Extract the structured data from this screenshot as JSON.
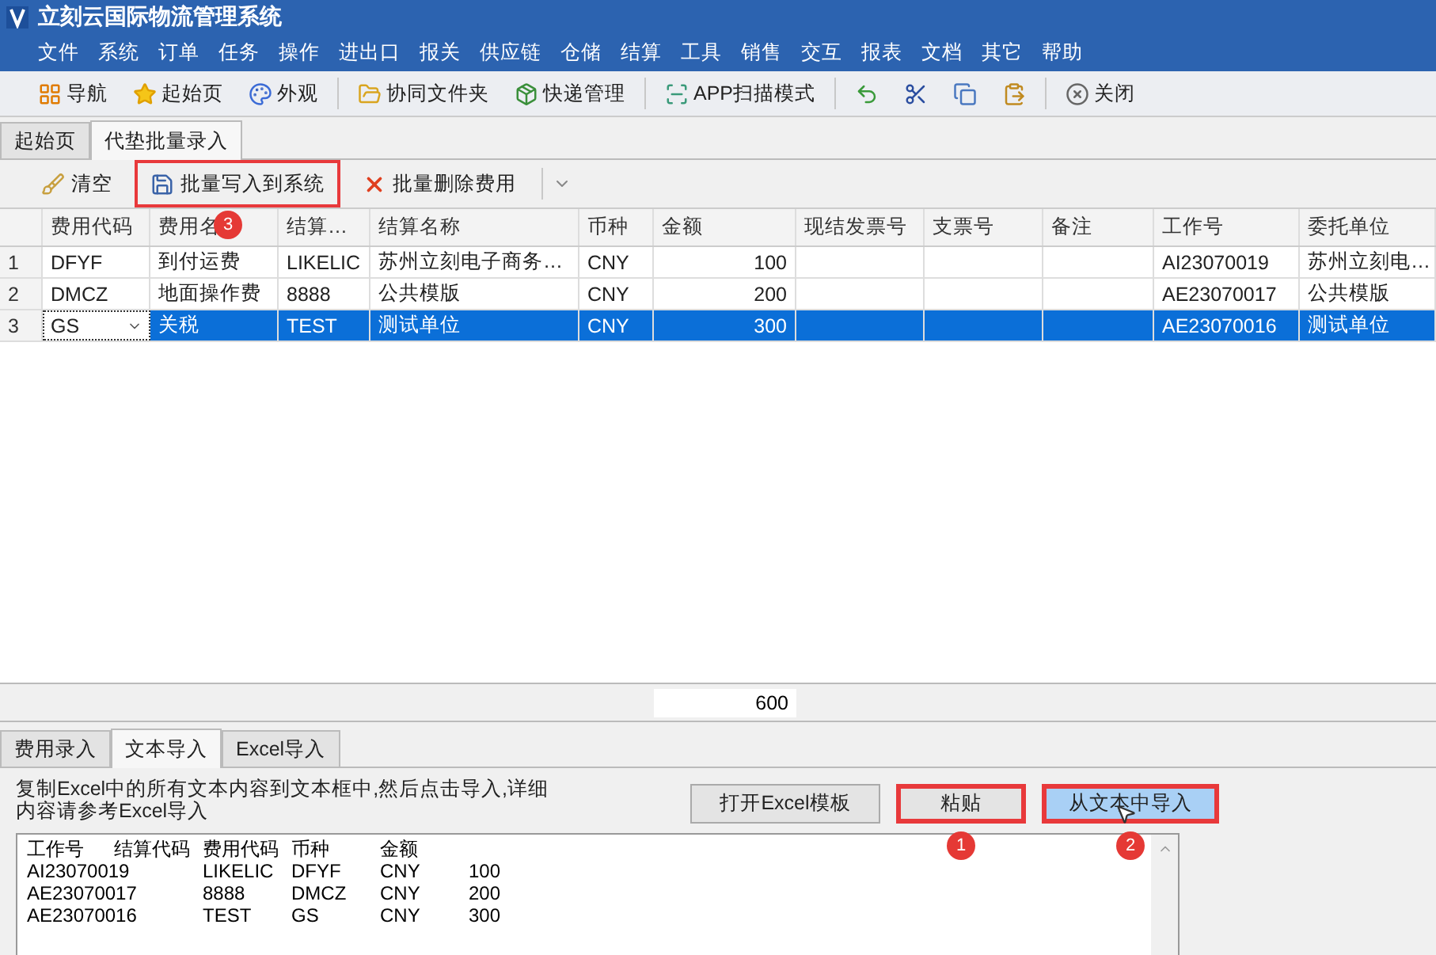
{
  "window": {
    "title": "立刻云国际物流管理系统"
  },
  "menu": [
    "文件",
    "系统",
    "订单",
    "任务",
    "操作",
    "进出口",
    "报关",
    "供应链",
    "仓储",
    "结算",
    "工具",
    "销售",
    "交互",
    "报表",
    "文档",
    "其它",
    "帮助"
  ],
  "toolbar": [
    {
      "kind": "button",
      "label": "导航"
    },
    {
      "kind": "button",
      "label": "起始页"
    },
    {
      "kind": "button",
      "label": "外观"
    },
    {
      "kind": "separator"
    },
    {
      "kind": "button",
      "label": "协同文件夹"
    },
    {
      "kind": "button",
      "label": "快递管理"
    },
    {
      "kind": "separator"
    },
    {
      "kind": "button",
      "label": "APP扫描模式"
    },
    {
      "kind": "separator"
    },
    {
      "kind": "icon"
    },
    {
      "kind": "icon"
    },
    {
      "kind": "icon"
    },
    {
      "kind": "icon"
    },
    {
      "kind": "separator"
    },
    {
      "kind": "button",
      "label": "关闭"
    }
  ],
  "doc_tabs": [
    {
      "label": "起始页",
      "selected": false
    },
    {
      "label": "代垫批量录入",
      "selected": true
    }
  ],
  "sub_toolbar": [
    {
      "label": "清空",
      "highlighted": false
    },
    {
      "label": "批量写入到系统",
      "highlighted": true,
      "badge": "3"
    },
    {
      "label": "批量删除费用",
      "highlighted": false
    }
  ],
  "table": {
    "columns": [
      "费用代码",
      "费用名",
      "结算…",
      "结算名称",
      "币种",
      "金额",
      "现结发票号",
      "支票号",
      "备注",
      "工作号",
      "委托单位"
    ],
    "rows": [
      {
        "num": "1",
        "selected": false,
        "cells": [
          "DFYF",
          "到付运费",
          "LIKELIC",
          "苏州立刻电子商务…",
          "CNY",
          "100",
          "",
          "",
          "",
          "AI23070019",
          "苏州立刻电…"
        ]
      },
      {
        "num": "2",
        "selected": false,
        "cells": [
          "DMCZ",
          "地面操作费",
          "8888",
          "公共模版",
          "CNY",
          "200",
          "",
          "",
          "",
          "AE23070017",
          "公共模版"
        ]
      },
      {
        "num": "3",
        "selected": true,
        "cells": [
          "GS",
          "关税",
          "TEST",
          "测试单位",
          "CNY",
          "300",
          "",
          "",
          "",
          "AE23070016",
          "测试单位"
        ]
      }
    ],
    "total": "600"
  },
  "bottom_tabs": [
    {
      "label": "费用录入",
      "selected": false
    },
    {
      "label": "文本导入",
      "selected": true
    },
    {
      "label": "Excel导入",
      "selected": false
    }
  ],
  "hint": "复制Excel中的所有文本内容到文本框中,然后点击导入,详细内容请参考Excel导入",
  "buttons": [
    {
      "label": "打开Excel模板",
      "highlighted": false,
      "hovered": false
    },
    {
      "label": "粘贴",
      "highlighted": true,
      "hovered": false,
      "badge": "1"
    },
    {
      "label": "从文本中导入",
      "highlighted": true,
      "hovered": true,
      "badge": "2"
    }
  ],
  "import_text": {
    "header": [
      "工作号",
      "结算代码",
      "费用代码",
      "币种",
      "金额"
    ],
    "rows": [
      [
        "AI23070019",
        "LIKELIC",
        "DFYF",
        "CNY",
        "100"
      ],
      [
        "AE23070017",
        "8888",
        "DMCZ",
        "CNY",
        "200"
      ],
      [
        "AE23070016",
        "TEST",
        "GS",
        "CNY",
        "300"
      ]
    ]
  }
}
